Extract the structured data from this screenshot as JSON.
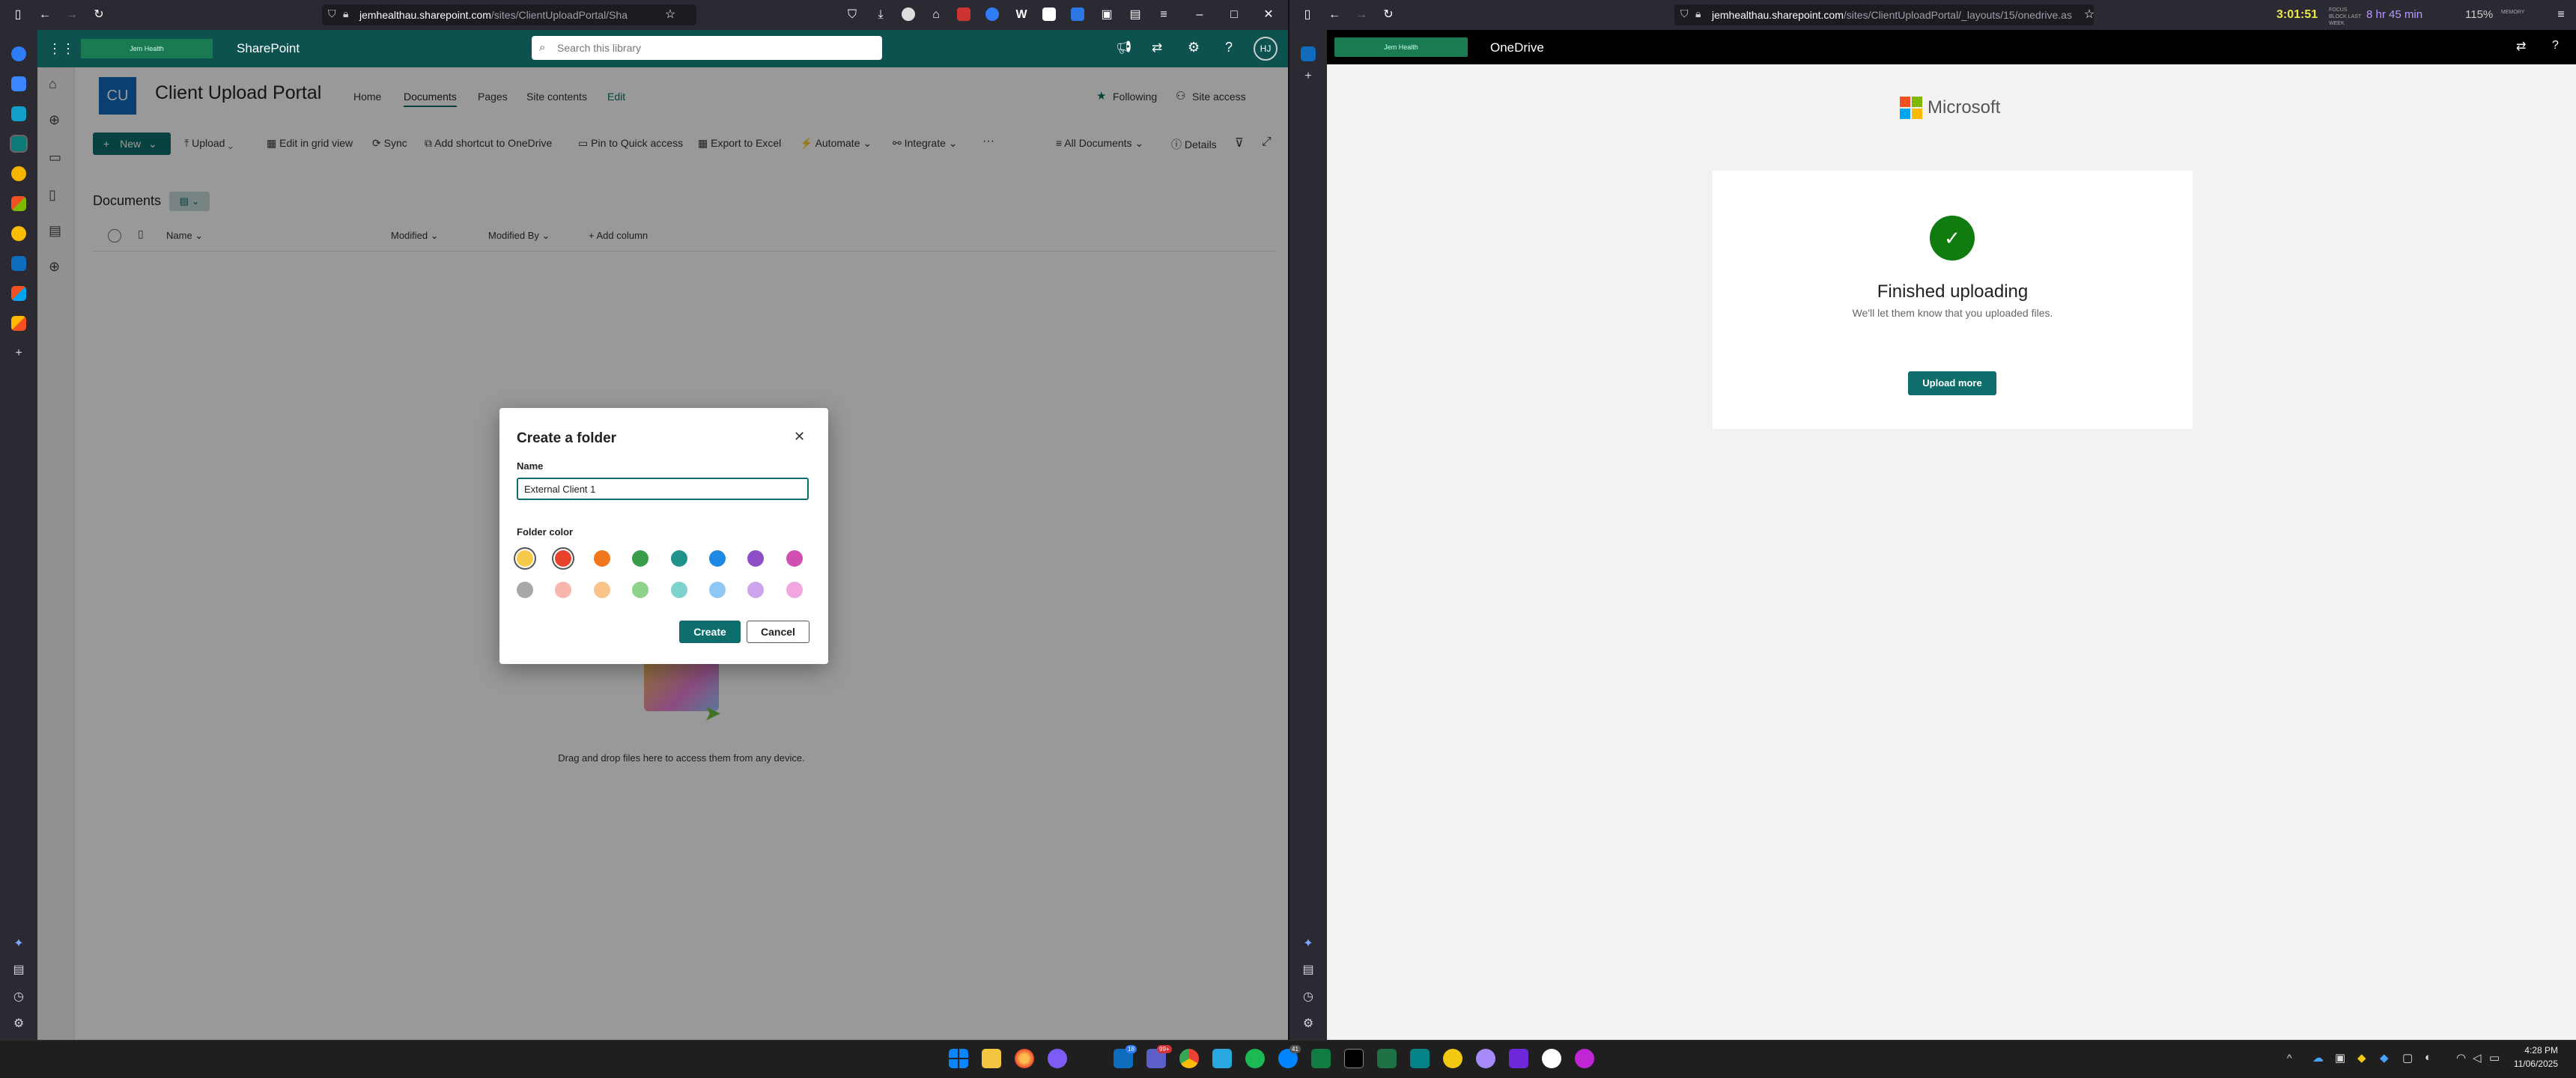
{
  "left_window": {
    "url_host": "jemhealthau.sharepoint.com",
    "url_path": "/sites/ClientUploadPortal/Sha",
    "app_name": "SharePoint",
    "org_logo_text": "Jem Health",
    "search_placeholder": "Search this library",
    "profile_initials": "HJ",
    "site_initials": "CU",
    "site_title": "Client Upload Portal",
    "site_nav": [
      "Home",
      "Documents",
      "Pages",
      "Site contents",
      "Edit"
    ],
    "following": "Following",
    "site_access": "Site access",
    "toolbar": {
      "new": "New",
      "upload": "Upload",
      "grid": "Edit in grid view",
      "sync": "Sync",
      "shortcut": "Add shortcut to OneDrive",
      "pin": "Pin to Quick access",
      "export": "Export to Excel",
      "automate": "Automate",
      "integrate": "Integrate",
      "more": "···",
      "view": "All Documents",
      "details": "Details"
    },
    "library_title": "Documents",
    "columns": [
      "Name",
      "Modified",
      "Modified By",
      "Add column"
    ],
    "empty_text": "Drag and drop files here to access them from any device."
  },
  "dialog": {
    "title": "Create a folder",
    "name_label": "Name",
    "name_value": "External Client 1",
    "color_label": "Folder color",
    "colors_row1": [
      "#f7c948",
      "#e8412c",
      "#f0771c",
      "#3a9d4a",
      "#21938a",
      "#1e88e5",
      "#8e4ec6",
      "#d14fb0"
    ],
    "colors_row2": [
      "#a8a8a8",
      "#f7b7ae",
      "#f9c389",
      "#8ed38b",
      "#7fd3cf",
      "#8fc8f5",
      "#cfa3ee",
      "#f2a6de"
    ],
    "selected_index": 0,
    "create": "Create",
    "cancel": "Cancel"
  },
  "right_window": {
    "url_host": "jemhealthau.sharepoint.com",
    "url_path": "/sites/ClientUploadPortal/_layouts/15/onedrive.as",
    "clock": "3:01:51",
    "clock_caption": "FOCUS BLOCK LAST WEEK",
    "timer": "8 hr 45 min",
    "zoom": "115%",
    "zoom_caption": "MEMORY",
    "app_name": "OneDrive",
    "org_logo_text": "Jem Health",
    "brand": "Microsoft",
    "finished_title": "Finished uploading",
    "finished_sub": "We'll let them know that you uploaded files.",
    "upload_more": "Upload more"
  },
  "taskbar": {
    "time": "4:28 PM",
    "date": "11/06/2025",
    "badge_1": "18",
    "badge_2": "99+",
    "badge_3": "41"
  },
  "colors": {
    "brand_teal": "#0e6e6c",
    "suite_bar": "#0e5250",
    "check_green": "#107c10"
  }
}
